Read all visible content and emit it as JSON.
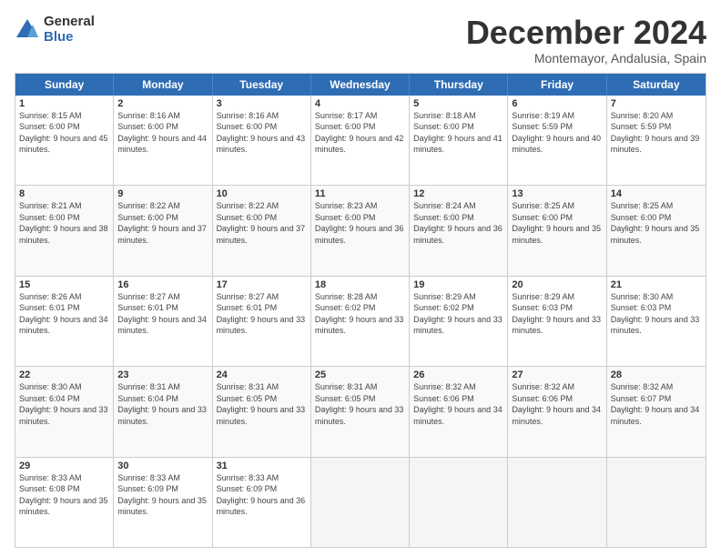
{
  "logo": {
    "general": "General",
    "blue": "Blue"
  },
  "title": "December 2024",
  "location": "Montemayor, Andalusia, Spain",
  "weekdays": [
    "Sunday",
    "Monday",
    "Tuesday",
    "Wednesday",
    "Thursday",
    "Friday",
    "Saturday"
  ],
  "weeks": [
    [
      {
        "day": "1",
        "rise": "8:15 AM",
        "set": "6:00 PM",
        "daylight": "9 hours and 45 minutes."
      },
      {
        "day": "2",
        "rise": "8:16 AM",
        "set": "6:00 PM",
        "daylight": "9 hours and 44 minutes."
      },
      {
        "day": "3",
        "rise": "8:16 AM",
        "set": "6:00 PM",
        "daylight": "9 hours and 43 minutes."
      },
      {
        "day": "4",
        "rise": "8:17 AM",
        "set": "6:00 PM",
        "daylight": "9 hours and 42 minutes."
      },
      {
        "day": "5",
        "rise": "8:18 AM",
        "set": "6:00 PM",
        "daylight": "9 hours and 41 minutes."
      },
      {
        "day": "6",
        "rise": "8:19 AM",
        "set": "5:59 PM",
        "daylight": "9 hours and 40 minutes."
      },
      {
        "day": "7",
        "rise": "8:20 AM",
        "set": "5:59 PM",
        "daylight": "9 hours and 39 minutes."
      }
    ],
    [
      {
        "day": "8",
        "rise": "8:21 AM",
        "set": "6:00 PM",
        "daylight": "9 hours and 38 minutes."
      },
      {
        "day": "9",
        "rise": "8:22 AM",
        "set": "6:00 PM",
        "daylight": "9 hours and 37 minutes."
      },
      {
        "day": "10",
        "rise": "8:22 AM",
        "set": "6:00 PM",
        "daylight": "9 hours and 37 minutes."
      },
      {
        "day": "11",
        "rise": "8:23 AM",
        "set": "6:00 PM",
        "daylight": "9 hours and 36 minutes."
      },
      {
        "day": "12",
        "rise": "8:24 AM",
        "set": "6:00 PM",
        "daylight": "9 hours and 36 minutes."
      },
      {
        "day": "13",
        "rise": "8:25 AM",
        "set": "6:00 PM",
        "daylight": "9 hours and 35 minutes."
      },
      {
        "day": "14",
        "rise": "8:25 AM",
        "set": "6:00 PM",
        "daylight": "9 hours and 35 minutes."
      }
    ],
    [
      {
        "day": "15",
        "rise": "8:26 AM",
        "set": "6:01 PM",
        "daylight": "9 hours and 34 minutes."
      },
      {
        "day": "16",
        "rise": "8:27 AM",
        "set": "6:01 PM",
        "daylight": "9 hours and 34 minutes."
      },
      {
        "day": "17",
        "rise": "8:27 AM",
        "set": "6:01 PM",
        "daylight": "9 hours and 33 minutes."
      },
      {
        "day": "18",
        "rise": "8:28 AM",
        "set": "6:02 PM",
        "daylight": "9 hours and 33 minutes."
      },
      {
        "day": "19",
        "rise": "8:29 AM",
        "set": "6:02 PM",
        "daylight": "9 hours and 33 minutes."
      },
      {
        "day": "20",
        "rise": "8:29 AM",
        "set": "6:03 PM",
        "daylight": "9 hours and 33 minutes."
      },
      {
        "day": "21",
        "rise": "8:30 AM",
        "set": "6:03 PM",
        "daylight": "9 hours and 33 minutes."
      }
    ],
    [
      {
        "day": "22",
        "rise": "8:30 AM",
        "set": "6:04 PM",
        "daylight": "9 hours and 33 minutes."
      },
      {
        "day": "23",
        "rise": "8:31 AM",
        "set": "6:04 PM",
        "daylight": "9 hours and 33 minutes."
      },
      {
        "day": "24",
        "rise": "8:31 AM",
        "set": "6:05 PM",
        "daylight": "9 hours and 33 minutes."
      },
      {
        "day": "25",
        "rise": "8:31 AM",
        "set": "6:05 PM",
        "daylight": "9 hours and 33 minutes."
      },
      {
        "day": "26",
        "rise": "8:32 AM",
        "set": "6:06 PM",
        "daylight": "9 hours and 34 minutes."
      },
      {
        "day": "27",
        "rise": "8:32 AM",
        "set": "6:06 PM",
        "daylight": "9 hours and 34 minutes."
      },
      {
        "day": "28",
        "rise": "8:32 AM",
        "set": "6:07 PM",
        "daylight": "9 hours and 34 minutes."
      }
    ],
    [
      {
        "day": "29",
        "rise": "8:33 AM",
        "set": "6:08 PM",
        "daylight": "9 hours and 35 minutes."
      },
      {
        "day": "30",
        "rise": "8:33 AM",
        "set": "6:09 PM",
        "daylight": "9 hours and 35 minutes."
      },
      {
        "day": "31",
        "rise": "8:33 AM",
        "set": "6:09 PM",
        "daylight": "9 hours and 36 minutes."
      },
      null,
      null,
      null,
      null
    ]
  ]
}
